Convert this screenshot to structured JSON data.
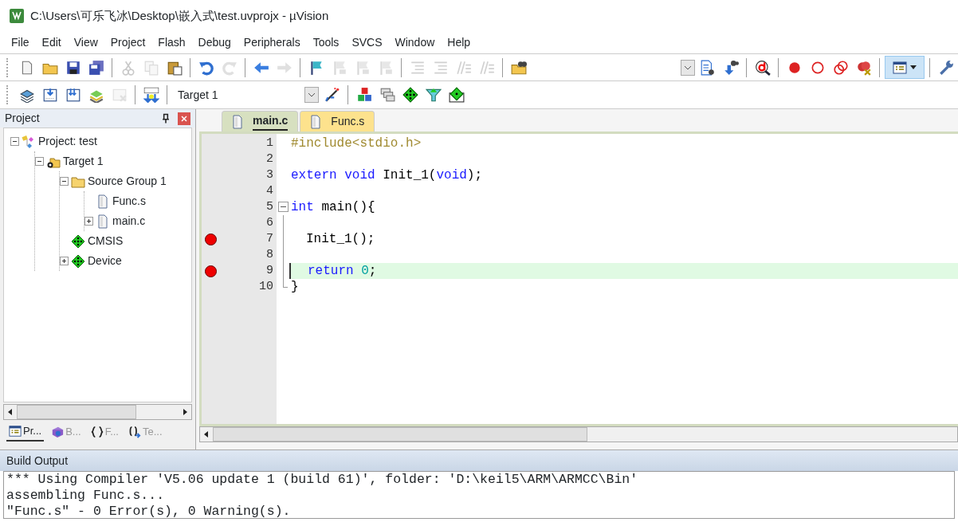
{
  "window": {
    "title": "C:\\Users\\可乐飞冰\\Desktop\\嵌入式\\test.uvprojx - µVision"
  },
  "menu": [
    "File",
    "Edit",
    "View",
    "Project",
    "Flash",
    "Debug",
    "Peripherals",
    "Tools",
    "SVCS",
    "Window",
    "Help"
  ],
  "toolbar_1": [
    {
      "kind": "icon",
      "disabled": false
    },
    {
      "kind": "icon",
      "disabled": false
    },
    {
      "kind": "icon",
      "disabled": false
    },
    {
      "kind": "icon",
      "disabled": false
    },
    {
      "kind": "separator"
    },
    {
      "kind": "icon",
      "disabled": true
    },
    {
      "kind": "icon",
      "disabled": true
    },
    {
      "kind": "icon",
      "disabled": false
    },
    {
      "kind": "separator"
    },
    {
      "kind": "icon",
      "disabled": false
    },
    {
      "kind": "icon",
      "disabled": true
    },
    {
      "kind": "separator"
    },
    {
      "kind": "icon",
      "disabled": false
    },
    {
      "kind": "icon",
      "disabled": true
    },
    {
      "kind": "separator"
    },
    {
      "kind": "icon",
      "disabled": false
    },
    {
      "kind": "icon",
      "disabled": true
    },
    {
      "kind": "icon",
      "disabled": true
    },
    {
      "kind": "icon",
      "disabled": true
    },
    {
      "kind": "separator"
    },
    {
      "kind": "icon",
      "disabled": true
    },
    {
      "kind": "icon",
      "disabled": true
    },
    {
      "kind": "icon",
      "disabled": true
    },
    {
      "kind": "icon",
      "disabled": true
    },
    {
      "kind": "separator"
    },
    {
      "kind": "icon",
      "disabled": false
    },
    {
      "kind": "spacer"
    },
    {
      "kind": "dropdown"
    },
    {
      "kind": "icon",
      "disabled": false
    },
    {
      "kind": "icon",
      "disabled": false
    },
    {
      "kind": "separator"
    },
    {
      "kind": "icon",
      "disabled": false
    },
    {
      "kind": "separator"
    },
    {
      "kind": "icon",
      "disabled": false
    },
    {
      "kind": "icon",
      "disabled": false
    },
    {
      "kind": "icon",
      "disabled": false
    },
    {
      "kind": "icon",
      "disabled": false
    },
    {
      "kind": "separator"
    },
    {
      "kind": "toggle",
      "selected": true
    },
    {
      "kind": "separator"
    },
    {
      "kind": "icon",
      "disabled": false
    }
  ],
  "toolbar_2": {
    "target": "Target 1",
    "icons_before": [
      {
        "disabled": false
      },
      {
        "disabled": false
      },
      {
        "disabled": false
      },
      {
        "disabled": false
      },
      {
        "disabled": true
      },
      {
        "disabled": false
      }
    ],
    "icons_after": [
      {
        "disabled": false
      },
      {
        "disabled": false
      },
      {
        "disabled": false
      },
      {
        "disabled": false
      },
      {
        "disabled": false
      },
      {
        "disabled": false
      }
    ]
  },
  "project_panel": {
    "title": "Project",
    "tree": [
      {
        "label": "Project: test",
        "kind": "project",
        "expanded": true,
        "children": [
          {
            "label": "Target 1",
            "kind": "target",
            "expanded": true,
            "children": [
              {
                "label": "Source Group 1",
                "kind": "group",
                "expanded": true,
                "children": [
                  {
                    "label": "Func.s",
                    "kind": "file"
                  },
                  {
                    "label": "main.c",
                    "kind": "file",
                    "expanded": false
                  }
                ]
              },
              {
                "label": "CMSIS",
                "kind": "component"
              },
              {
                "label": "Device",
                "kind": "component",
                "expanded": false
              }
            ]
          }
        ]
      }
    ],
    "tabs": [
      {
        "label": "Pr...",
        "kind": "project",
        "selected": true
      },
      {
        "label": "B...",
        "kind": "books",
        "selected": false
      },
      {
        "label": "F...",
        "kind": "functions",
        "selected": false
      },
      {
        "label": "Te...",
        "kind": "templates",
        "selected": false
      }
    ]
  },
  "editor": {
    "tabs": [
      {
        "label": "main.c",
        "selected": true
      },
      {
        "label": "Func.s",
        "selected": false
      }
    ],
    "lines": [
      {
        "number": "1",
        "breakpoint": false,
        "current": false,
        "tokens": [
          {
            "kind": "preprocessor",
            "text": "#include<stdio.h>"
          }
        ]
      },
      {
        "number": "2",
        "breakpoint": false,
        "current": false
      },
      {
        "number": "3",
        "breakpoint": false,
        "current": false,
        "tokens": [
          {
            "kind": "keyword",
            "text": "extern void"
          },
          {
            "kind": "plain",
            "text": " Init_1("
          },
          {
            "kind": "keyword",
            "text": "void"
          },
          {
            "kind": "plain",
            "text": ");"
          }
        ]
      },
      {
        "number": "4",
        "breakpoint": false,
        "current": false
      },
      {
        "number": "5",
        "breakpoint": false,
        "current": false,
        "expanded": true,
        "tokens": [
          {
            "kind": "keyword",
            "text": "int"
          },
          {
            "kind": "plain",
            "text": " main(){"
          }
        ]
      },
      {
        "number": "6",
        "breakpoint": false,
        "current": false
      },
      {
        "number": "7",
        "breakpoint": true,
        "current": false,
        "indented": true,
        "tokens": [
          {
            "kind": "plain",
            "text": "Init_1();"
          }
        ]
      },
      {
        "number": "8",
        "breakpoint": false,
        "current": false
      },
      {
        "number": "9",
        "breakpoint": true,
        "current": true,
        "indented": true,
        "tokens": [
          {
            "kind": "keyword",
            "text": "return"
          },
          {
            "kind": "number",
            "text": " 0"
          },
          {
            "kind": "plain",
            "text": ";"
          }
        ]
      },
      {
        "number": "10",
        "breakpoint": false,
        "current": false,
        "fold_end": true,
        "tokens": [
          {
            "kind": "plain",
            "text": "}"
          }
        ]
      }
    ]
  },
  "build_output": {
    "title": "Build Output",
    "lines": [
      "*** Using Compiler 'V5.06 update 1 (build 61)', folder: 'D:\\keil5\\ARM\\ARMCC\\Bin'",
      "assembling Func.s...",
      "\"Func.s\" - 0 Error(s), 0 Warning(s)."
    ]
  }
}
